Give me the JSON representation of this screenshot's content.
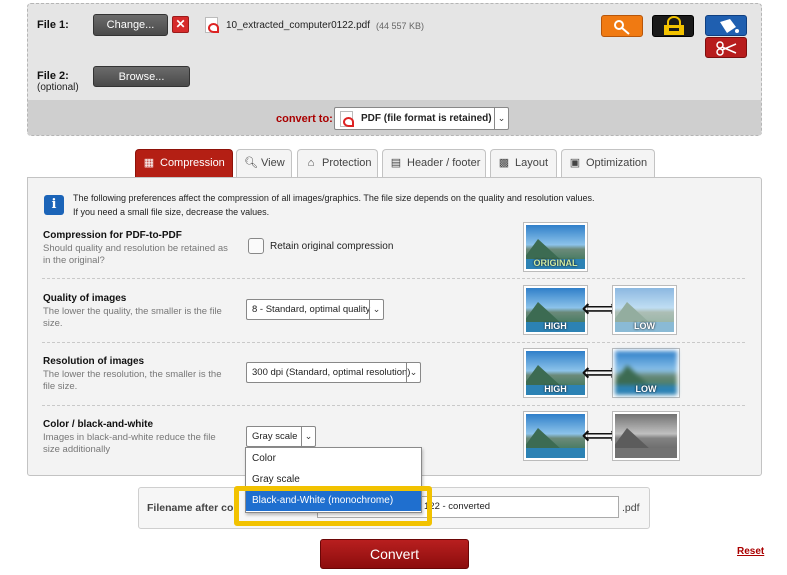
{
  "file1": {
    "label": "File 1:",
    "change_label": "Change...",
    "remove_icon": "x-icon",
    "filename": "10_extracted_computer0122.pdf",
    "filesize": "(44 557 KB)"
  },
  "file2": {
    "label": "File 2:",
    "sublabel": "(optional)",
    "browse_label": "Browse..."
  },
  "toolbar": {
    "icons": [
      "key-icon",
      "lock-icon",
      "paint-bucket-icon",
      "scissors-icon"
    ]
  },
  "convert_to": {
    "label": "convert to:",
    "value": "PDF (file format is retained)"
  },
  "tabs": [
    {
      "label": "Compression",
      "icon": "compress-icon"
    },
    {
      "label": "View",
      "icon": "magnifier-icon"
    },
    {
      "label": "Protection",
      "icon": "lock-icon"
    },
    {
      "label": "Header / footer",
      "icon": "page-icon"
    },
    {
      "label": "Layout",
      "icon": "grid-icon"
    },
    {
      "label": "Optimization",
      "icon": "optimize-icon"
    }
  ],
  "info": {
    "line1": "The following preferences affect the compression of all images/graphics. The file size depends on the quality and resolution values.",
    "line2": "If you need a small file size, decrease the values."
  },
  "rows": [
    {
      "title": "Compression for PDF-to-PDF",
      "desc": "Should quality and resolution be retained as in the original?",
      "control_label": "Retain original compression",
      "thumb_tag": "ORIGINAL"
    },
    {
      "title": "Quality of images",
      "desc": "The lower the quality, the smaller is the file size.",
      "value": "8 - Standard, optimal quality",
      "tag_left": "HIGH",
      "tag_right": "LOW"
    },
    {
      "title": "Resolution of images",
      "desc": "The lower the resolution, the smaller is the file size.",
      "value": "300 dpi (Standard, optimal resolution)",
      "tag_left": "HIGH",
      "tag_right": "LOW"
    },
    {
      "title": "Color / black-and-white",
      "desc": "Images in black-and-white reduce the file size additionally",
      "value": "Gray scale"
    }
  ],
  "color_options": [
    "Color",
    "Gray scale",
    "Black-and-White (monochrome)"
  ],
  "color_selected_index": 2,
  "filename_section": {
    "label": "Filename after co",
    "value": "122 - converted",
    "ext": ".pdf"
  },
  "convert_button": "Convert",
  "reset_link": "Reset",
  "colors": {
    "accent": "#b41f14",
    "highlight": "#f2c200",
    "selection": "#1f6fcf"
  }
}
